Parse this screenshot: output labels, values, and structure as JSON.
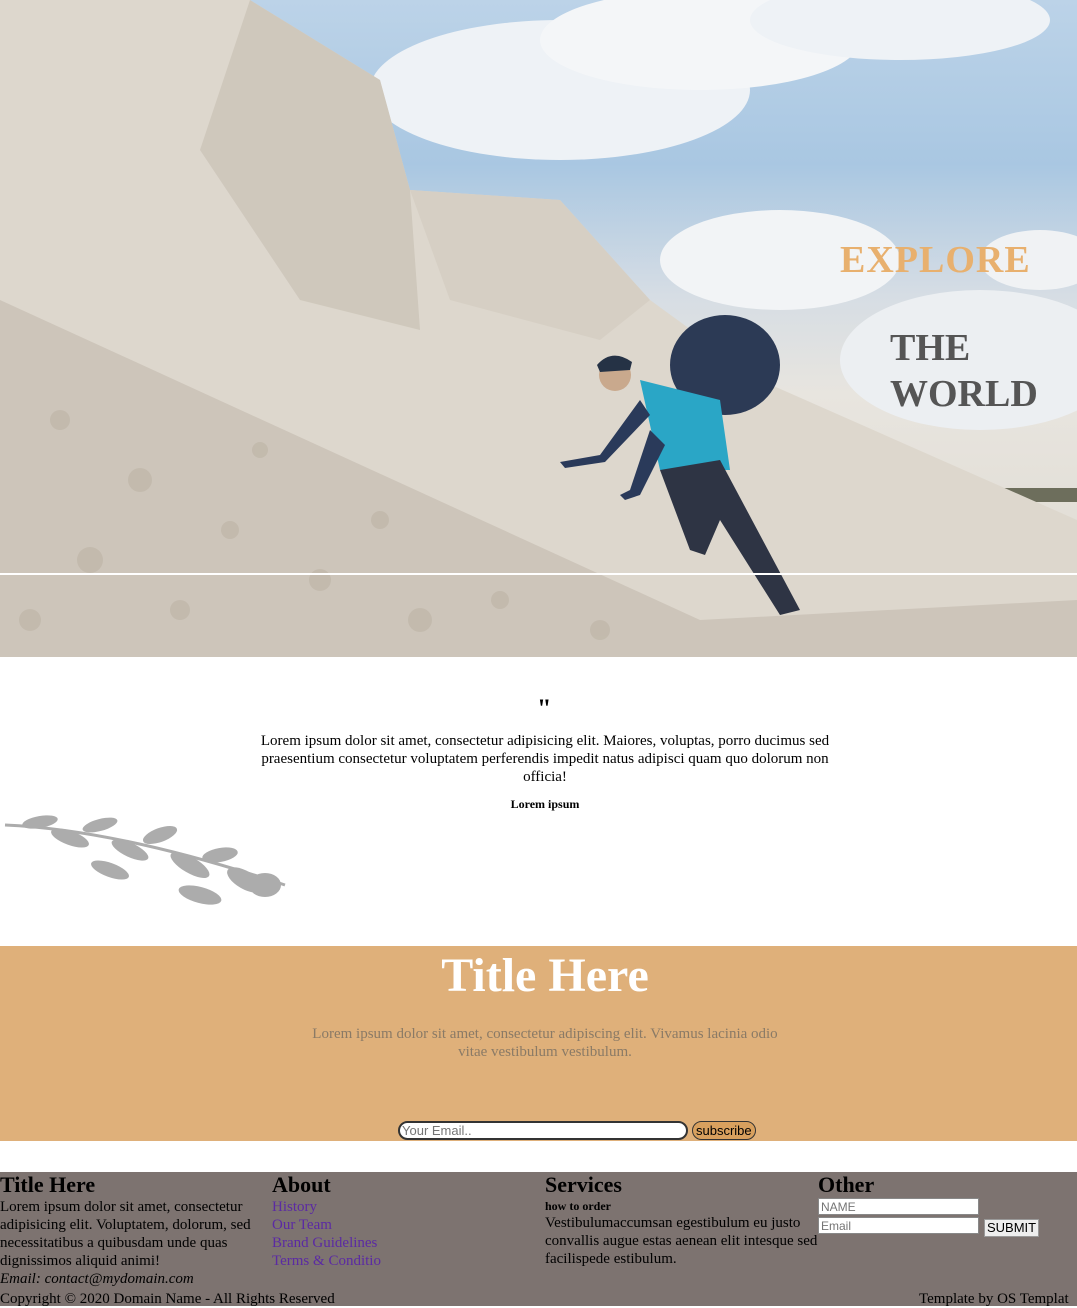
{
  "hero": {
    "title_line1": "EXPLORE",
    "title_line2": "THE WORLD"
  },
  "testimonial": {
    "quote_mark": "\"",
    "text": "Lorem ipsum dolor sit amet, consectetur adipisicing elit. Maiores, voluptas, porro ducimus sed praesentium consectetur voluptatem perferendis impedit natus adipisci quam quo dolorum non officia!",
    "author": "Lorem ipsum"
  },
  "banner": {
    "title": "Title Here",
    "text": "Lorem ipsum dolor sit amet, consectetur adipiscing elit. Vivamus lacinia odio vitae vestibulum vestibulum.",
    "email_placeholder": "Your Email..",
    "subscribe_label": "subscribe",
    "color": "#dfb07a"
  },
  "footer": {
    "col1": {
      "title": "Title Here",
      "text": "Lorem ipsum dolor sit amet, consectetur adipisicing elit. Voluptatem, dolorum, sed necessitatibus a quibusdam unde quas dignissimos aliquid animi!",
      "email": "Email: contact@mydomain.com"
    },
    "col2": {
      "title": "About",
      "links": [
        "History",
        "Our Team",
        "Brand Guidelines",
        "Terms & Conditio"
      ]
    },
    "col3": {
      "title": "Services",
      "subtitle": "how to order",
      "text": "Vestibulumaccumsan egestibulum eu justo convallis augue estas aenean elit intesque sed facilispede estibulum."
    },
    "col4": {
      "title": "Other",
      "name_placeholder": "NAME",
      "email_placeholder": "Email",
      "submit_label": "SUBMIT"
    },
    "copyright": "Copyright © 2020 Domain Name - All Rights Reserved",
    "credit": "Template by OS Templat",
    "color": "#7d7370"
  }
}
